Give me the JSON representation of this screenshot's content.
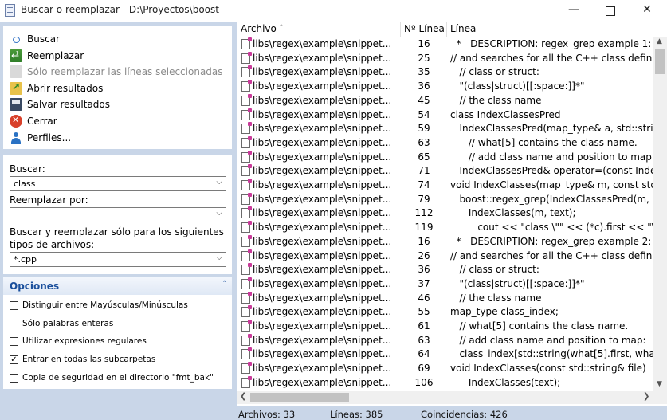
{
  "window": {
    "title": "Buscar o reemplazar - D:\\Proyectos\\boost",
    "minimize": "—",
    "close": "✕"
  },
  "actions": [
    {
      "label": "Buscar",
      "icon": "search-document-icon",
      "enabled": true
    },
    {
      "label": "Reemplazar",
      "icon": "replace-icon",
      "enabled": true
    },
    {
      "label": "Sólo reemplazar las líneas seleccionadas",
      "icon": "replace-selected-icon",
      "enabled": false
    },
    {
      "label": "Abrir resultados",
      "icon": "open-results-icon",
      "enabled": true
    },
    {
      "label": "Salvar resultados",
      "icon": "save-icon",
      "enabled": true
    },
    {
      "label": "Cerrar",
      "icon": "close-icon",
      "enabled": true
    },
    {
      "label": "Perfiles...",
      "icon": "user-icon",
      "enabled": true
    }
  ],
  "search": {
    "find_label": "Buscar:",
    "find_value": "class",
    "replace_label": "Reemplazar por:",
    "replace_value": "",
    "filetypes_label": "Buscar y reemplazar sólo para los siguientes tipos de archivos:",
    "filetypes_value": "*.cpp",
    "chevron": "⌵"
  },
  "options": {
    "title": "Opciones",
    "collapse": "˄",
    "items": [
      {
        "label": "Distinguir entre Mayúsculas/Minúsculas",
        "checked": false
      },
      {
        "label": "Sólo palabras enteras",
        "checked": false
      },
      {
        "label": "Utilizar expresiones regulares",
        "checked": false
      },
      {
        "label": "Entrar en todas las subcarpetas",
        "checked": true
      },
      {
        "label": "Copia de seguridad en el directorio \"fmt_bak\"",
        "checked": false
      }
    ],
    "check_glyph": "✓"
  },
  "results": {
    "columns": {
      "file": "Archivo",
      "line_no": "Nº Línea",
      "line": "Línea"
    },
    "sort_glyph": "^",
    "rows": [
      {
        "file": "libs\\regex\\example\\snippet...",
        "line": "16",
        "code": "  *   DESCRIPTION: regex_grep example 1: se"
      },
      {
        "file": "libs\\regex\\example\\snippet...",
        "line": "25",
        "code": "// and searches for all the C++ class defini"
      },
      {
        "file": "libs\\regex\\example\\snippet...",
        "line": "35",
        "code": "   // class or struct:"
      },
      {
        "file": "libs\\regex\\example\\snippet...",
        "line": "36",
        "code": "   \"(class|struct)[[:space:]]*\""
      },
      {
        "file": "libs\\regex\\example\\snippet...",
        "line": "45",
        "code": "   // the class name"
      },
      {
        "file": "libs\\regex\\example\\snippet...",
        "line": "54",
        "code": "class IndexClassesPred"
      },
      {
        "file": "libs\\regex\\example\\snippet...",
        "line": "59",
        "code": "   IndexClassesPred(map_type& a, std::string"
      },
      {
        "file": "libs\\regex\\example\\snippet...",
        "line": "63",
        "code": "      // what[5] contains the class name."
      },
      {
        "file": "libs\\regex\\example\\snippet...",
        "line": "65",
        "code": "      // add class name and position to map:"
      },
      {
        "file": "libs\\regex\\example\\snippet...",
        "line": "71",
        "code": "   IndexClassesPred& operator=(const Index"
      },
      {
        "file": "libs\\regex\\example\\snippet...",
        "line": "74",
        "code": "void IndexClasses(map_type& m, const std::s"
      },
      {
        "file": "libs\\regex\\example\\snippet...",
        "line": "79",
        "code": "   boost::regex_grep(IndexClassesPred(m, st"
      },
      {
        "file": "libs\\regex\\example\\snippet...",
        "line": "112",
        "code": "      IndexClasses(m, text);"
      },
      {
        "file": "libs\\regex\\example\\snippet...",
        "line": "119",
        "code": "         cout << \"class \\\"\" << (*c).first << \"\\\""
      },
      {
        "file": "libs\\regex\\example\\snippet...",
        "line": "16",
        "code": "  *   DESCRIPTION: regex_grep example 2: se"
      },
      {
        "file": "libs\\regex\\example\\snippet...",
        "line": "26",
        "code": "// and searches for all the C++ class defini"
      },
      {
        "file": "libs\\regex\\example\\snippet...",
        "line": "36",
        "code": "   // class or struct:"
      },
      {
        "file": "libs\\regex\\example\\snippet...",
        "line": "37",
        "code": "   \"(class|struct)[[:space:]]*\""
      },
      {
        "file": "libs\\regex\\example\\snippet...",
        "line": "46",
        "code": "   // the class name"
      },
      {
        "file": "libs\\regex\\example\\snippet...",
        "line": "55",
        "code": "map_type class_index;"
      },
      {
        "file": "libs\\regex\\example\\snippet...",
        "line": "61",
        "code": "   // what[5] contains the class name."
      },
      {
        "file": "libs\\regex\\example\\snippet...",
        "line": "63",
        "code": "   // add class name and position to map:"
      },
      {
        "file": "libs\\regex\\example\\snippet...",
        "line": "64",
        "code": "   class_index[std::string(what[5].first, what"
      },
      {
        "file": "libs\\regex\\example\\snippet...",
        "line": "69",
        "code": "void IndexClasses(const std::string& file)"
      },
      {
        "file": "libs\\regex\\example\\snippet...",
        "line": "106",
        "code": "      IndexClasses(text);"
      }
    ]
  },
  "scrollbars": {
    "up": "▲",
    "down": "▼",
    "left": "❮",
    "right": "❯"
  },
  "status": {
    "files": "Archivos: 33",
    "lines": "Líneas: 385",
    "matches": "Coincidencias: 426"
  }
}
